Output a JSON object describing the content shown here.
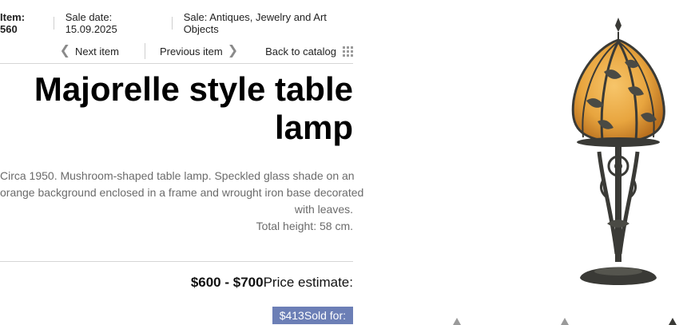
{
  "header": {
    "item": "Item: 560",
    "sale_date": "Sale date: 15.09.2025",
    "sale": "Sale: Antiques, Jewelry and Art Objects"
  },
  "nav": {
    "next": "Next item",
    "previous": "Previous item",
    "back": "Back to catalog"
  },
  "title": "Majorelle style table lamp",
  "description": [
    "Circa 1950. Mushroom-shaped table lamp. Speckled glass shade on an",
    "orange background enclosed in a frame and wrought iron base decorated",
    "with leaves.",
    "Total height: 58 cm."
  ],
  "price": {
    "estimate_value": "$600 - $700",
    "estimate_label": "Price estimate:",
    "sold_value": "$413",
    "sold_label": "Sold for:"
  },
  "colors": {
    "sold_badge": "#6c7fb6",
    "shade_orange": "#e8a53f",
    "iron": "#3a3a36"
  },
  "icons": [
    "chevron-left-icon",
    "chevron-right-icon",
    "grid-icon"
  ]
}
